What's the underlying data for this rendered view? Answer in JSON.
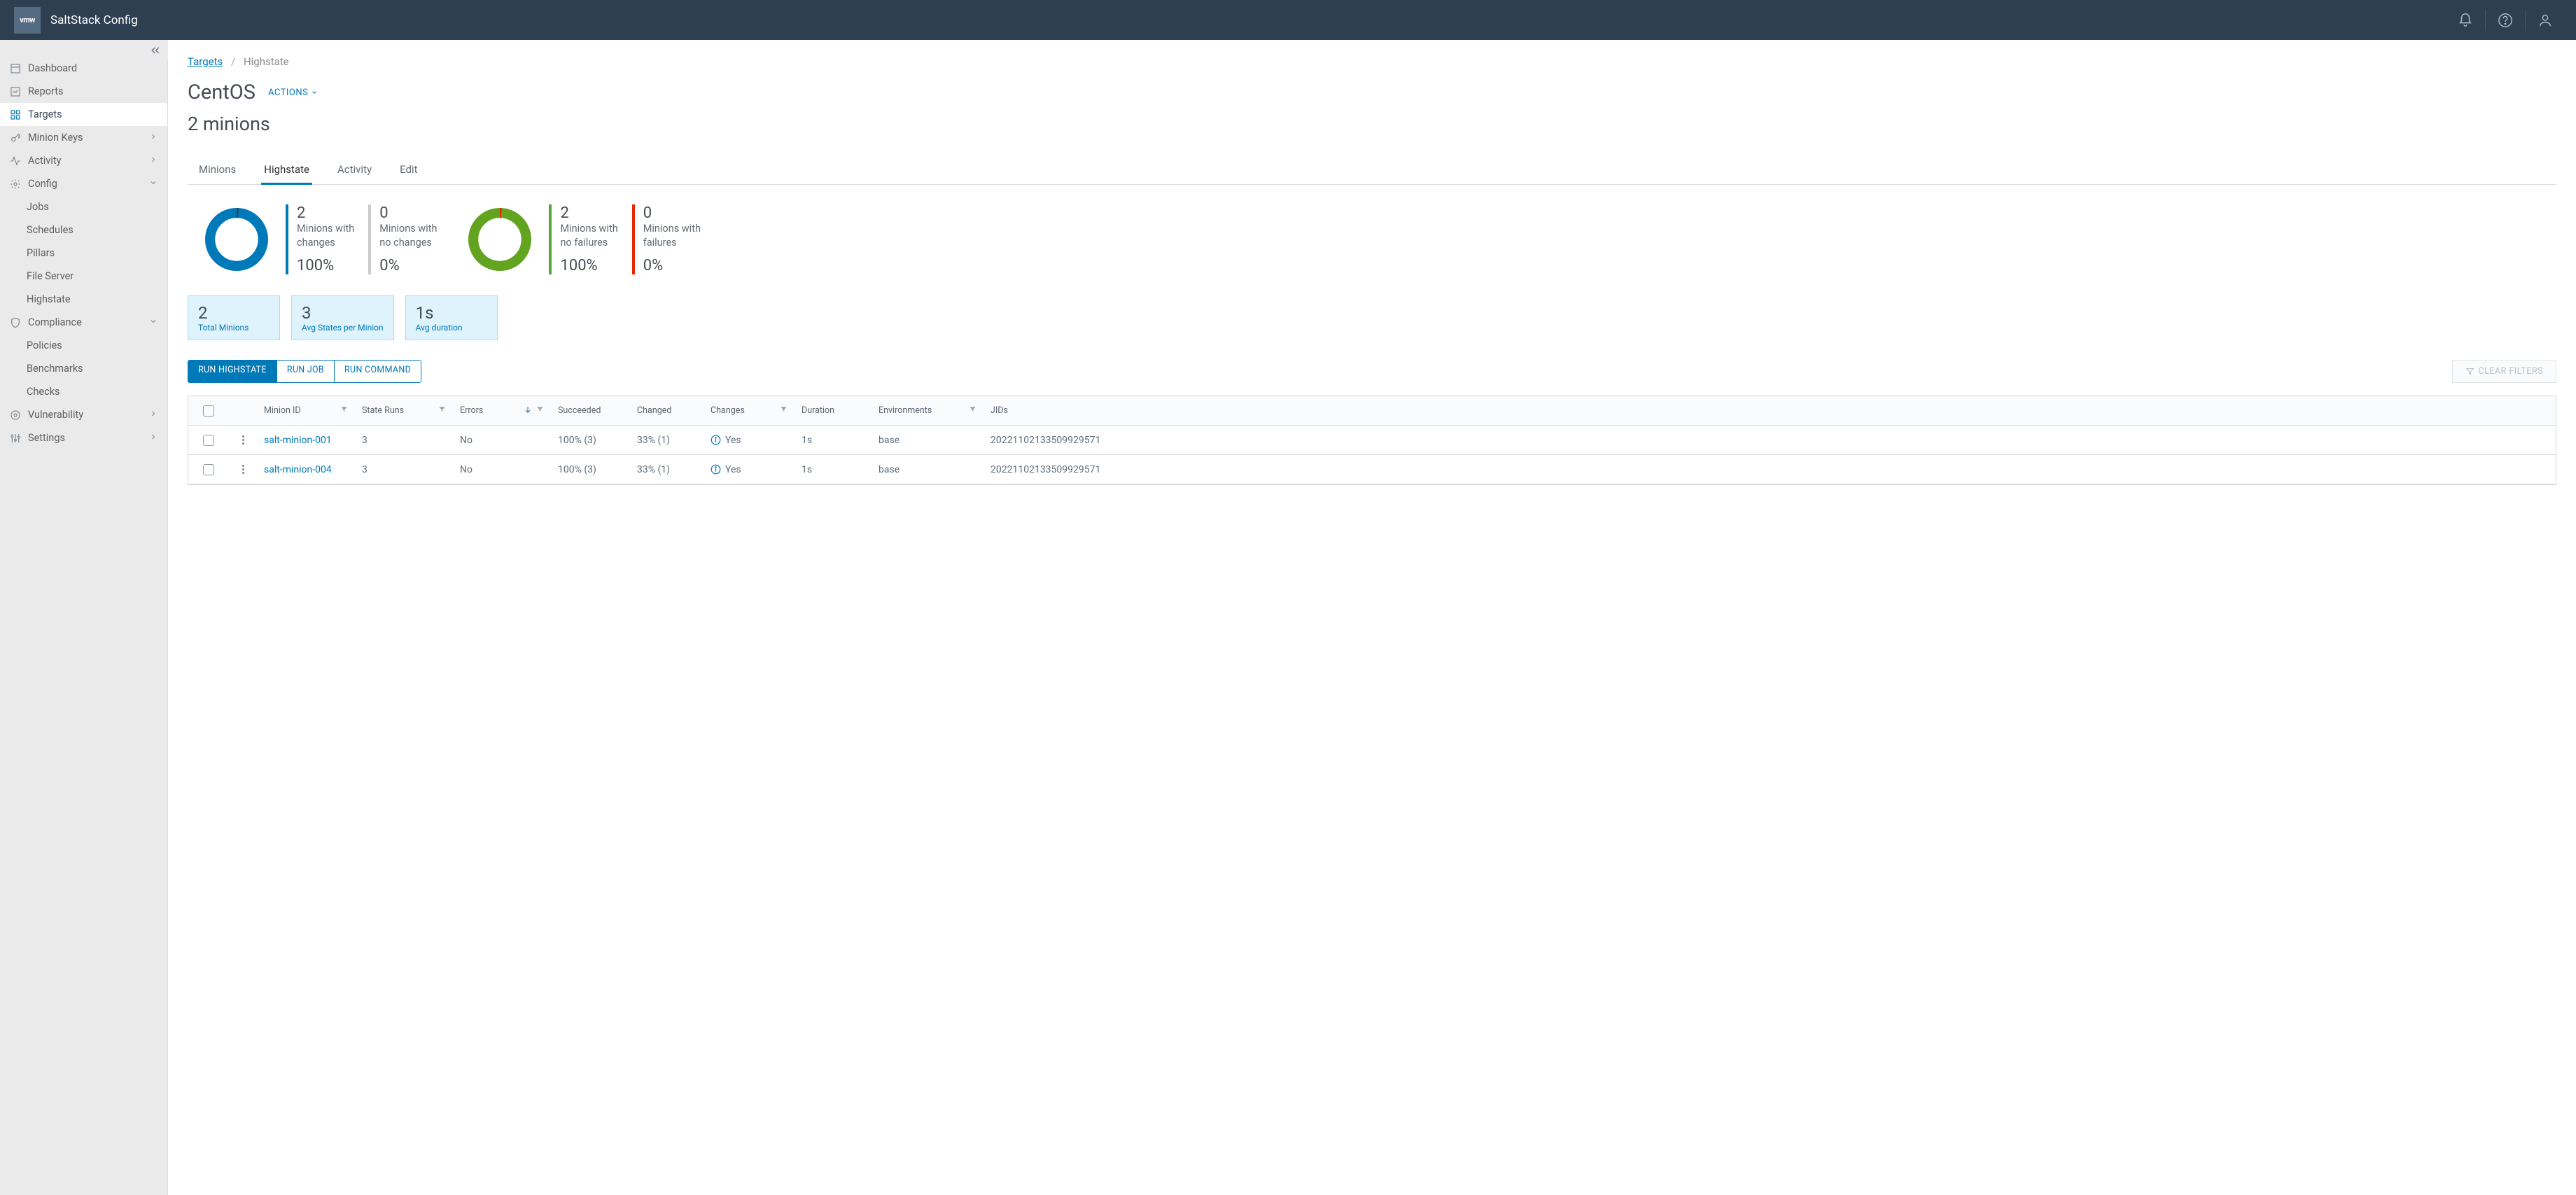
{
  "header": {
    "logo_text": "vmw",
    "app_title": "SaltStack Config"
  },
  "sidebar": {
    "dashboard": "Dashboard",
    "reports": "Reports",
    "targets": "Targets",
    "minion_keys": "Minion Keys",
    "activity": "Activity",
    "config": "Config",
    "config_children": {
      "jobs": "Jobs",
      "schedules": "Schedules",
      "pillars": "Pillars",
      "file_server": "File Server",
      "highstate": "Highstate"
    },
    "compliance": "Compliance",
    "compliance_children": {
      "policies": "Policies",
      "benchmarks": "Benchmarks",
      "checks": "Checks"
    },
    "vulnerability": "Vulnerability",
    "settings": "Settings"
  },
  "breadcrumb": {
    "root": "Targets",
    "current": "Highstate"
  },
  "page": {
    "title": "CentOS",
    "actions_label": "ACTIONS",
    "subtitle": "2 minions"
  },
  "tabs": {
    "minions": "Minions",
    "highstate": "Highstate",
    "activity": "Activity",
    "edit": "Edit"
  },
  "stats": {
    "changes": {
      "count": "2",
      "label_l1": "Minions with",
      "label_l2": "changes",
      "pct": "100%"
    },
    "no_changes": {
      "count": "0",
      "label_l1": "Minions with",
      "label_l2": "no changes",
      "pct": "0%"
    },
    "no_failures": {
      "count": "2",
      "label_l1": "Minions with",
      "label_l2": "no failures",
      "pct": "100%"
    },
    "failures": {
      "count": "0",
      "label_l1": "Minions with",
      "label_l2": "failures",
      "pct": "0%"
    }
  },
  "cards": {
    "total_minions": {
      "num": "2",
      "label": "Total Minions"
    },
    "avg_states": {
      "num": "3",
      "label": "Avg States per Minion"
    },
    "avg_duration": {
      "num": "1s",
      "label": "Avg duration"
    }
  },
  "buttons": {
    "run_highstate": "RUN HIGHSTATE",
    "run_job": "RUN JOB",
    "run_command": "RUN COMMAND",
    "clear_filters": "CLEAR FILTERS"
  },
  "table": {
    "headers": {
      "minion_id": "Minion ID",
      "state_runs": "State Runs",
      "errors": "Errors",
      "succeeded": "Succeeded",
      "changed": "Changed",
      "changes": "Changes",
      "duration": "Duration",
      "environments": "Environments",
      "jids": "JIDs"
    },
    "rows": [
      {
        "minion_id": "salt-minion-001",
        "state_runs": "3",
        "errors": "No",
        "succeeded": "100% (3)",
        "changed": "33% (1)",
        "changes": "Yes",
        "duration": "1s",
        "environments": "base",
        "jids": "20221102133509929571"
      },
      {
        "minion_id": "salt-minion-004",
        "state_runs": "3",
        "errors": "No",
        "succeeded": "100% (3)",
        "changed": "33% (1)",
        "changes": "Yes",
        "duration": "1s",
        "environments": "base",
        "jids": "20221102133509929571"
      }
    ]
  },
  "chart_data": [
    {
      "type": "pie",
      "title": "Changes",
      "series": [
        {
          "name": "Minions with changes",
          "value": 2
        },
        {
          "name": "Minions with no changes",
          "value": 0
        }
      ],
      "colors": [
        "#0079b8",
        "#cbd4db"
      ]
    },
    {
      "type": "pie",
      "title": "Failures",
      "series": [
        {
          "name": "Minions with no failures",
          "value": 2
        },
        {
          "name": "Minions with failures",
          "value": 0
        }
      ],
      "colors": [
        "#62a420",
        "#e62700"
      ]
    }
  ],
  "colors": {
    "accent": "#0079b8",
    "green": "#62a420",
    "red": "#e62700",
    "header": "#2d3f51"
  }
}
